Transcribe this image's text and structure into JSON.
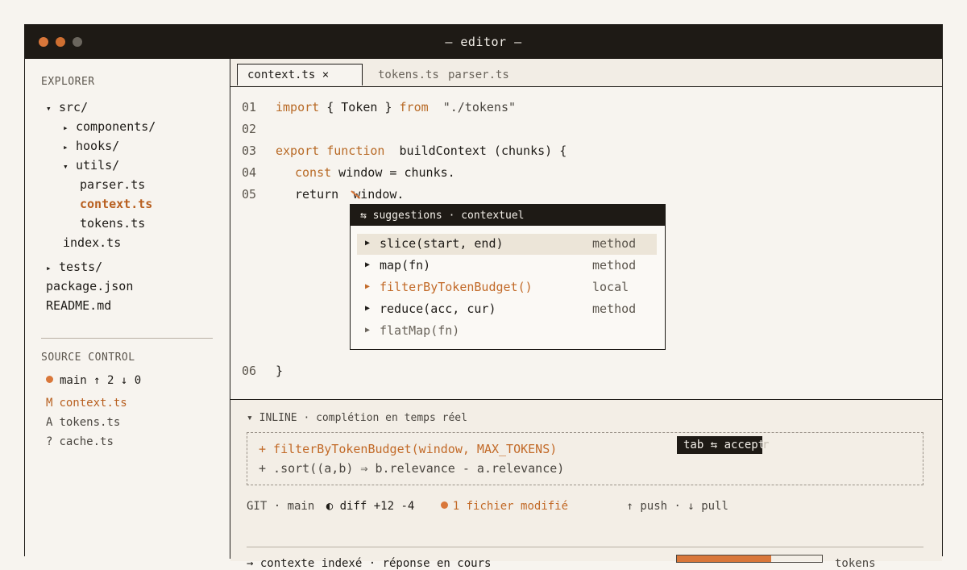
{
  "window": {
    "title": "— editor —"
  },
  "explorer": {
    "header": "EXPLORER",
    "tree": [
      {
        "label": "src/",
        "marker": "▾"
      },
      {
        "label": "components/",
        "marker": "▸"
      },
      {
        "label": "hooks/",
        "marker": "▸"
      },
      {
        "label": "utils/",
        "marker": "▾"
      },
      {
        "label": "parser.ts"
      },
      {
        "label": "context.ts"
      },
      {
        "label": "tokens.ts"
      },
      {
        "label": "index.ts"
      },
      {
        "label": "tests/",
        "marker": "▸"
      },
      {
        "label": "package.json"
      },
      {
        "label": "README.md"
      }
    ]
  },
  "source_control": {
    "header": "SOURCE CONTROL",
    "branch": "main ↑ 2 ↓ 0",
    "files": [
      {
        "flag": "M",
        "name": "context.ts"
      },
      {
        "flag": "A",
        "name": "tokens.ts"
      },
      {
        "flag": "?",
        "name": "cache.ts"
      }
    ]
  },
  "tabs": [
    {
      "label": "context.ts ×"
    },
    {
      "label": "tokens.ts"
    },
    {
      "label": "parser.ts"
    }
  ],
  "code": {
    "lines": [
      {
        "n": "01",
        "t": [
          "import",
          " { Token } ",
          "from",
          "  \"./tokens\""
        ]
      },
      {
        "n": "02",
        "t": []
      },
      {
        "n": "03",
        "t": [
          "export function",
          "  buildContext (chunks) {"
        ]
      },
      {
        "n": "04",
        "t": [
          "const",
          " window = chunks."
        ]
      },
      {
        "n": "05",
        "t": [
          "return  window."
        ]
      },
      {
        "n": "06",
        "t": [
          "}"
        ]
      }
    ]
  },
  "suggestions": {
    "header": "⇆ suggestions · contextuel",
    "items": [
      {
        "name": "slice(start, end)",
        "kind": "method"
      },
      {
        "name": "map(fn)",
        "kind": "method"
      },
      {
        "name": "filterByTokenBudget()",
        "kind": "local"
      },
      {
        "name": "reduce(acc, cur)",
        "kind": "method"
      },
      {
        "name": "flatMap(fn)",
        "kind": ""
      }
    ]
  },
  "inline": {
    "header": "▾ INLINE · complétion en temps réel",
    "line1": "+ filterByTokenBudget(window, MAX_TOKENS)",
    "line2": "+ .sort((a,b) ⇒ b.relevance - a.relevance)",
    "hint": "tab ⇆ accepter",
    "hint_ghost": "r"
  },
  "git": {
    "prefix": "GIT · main",
    "diff": "◐ diff +12 -4",
    "modified": "1 fichier modifié",
    "sync": "↑ push · ↓ pull"
  },
  "status": {
    "text": "→ contexte indexé · réponse en cours",
    "progress": 0.65,
    "tokens_label": "tokens"
  },
  "colors": {
    "accent": "#d9773a",
    "dark": "#1e1a15",
    "background": "#f7f4ef"
  }
}
